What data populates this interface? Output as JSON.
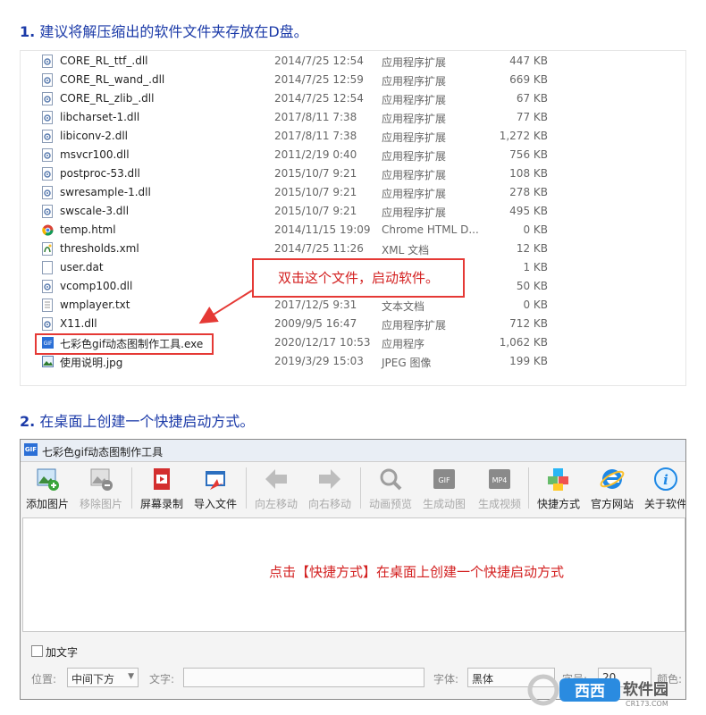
{
  "step1": {
    "num": "1.",
    "text": "建议将解压缩出的软件文件夹存放在D盘。"
  },
  "files": [
    {
      "name": "CORE_RL_ttf_.dll",
      "date": "2014/7/25 12:54",
      "type": "应用程序扩展",
      "size": "447 KB",
      "icon": "dll-icon"
    },
    {
      "name": "CORE_RL_wand_.dll",
      "date": "2014/7/25 12:59",
      "type": "应用程序扩展",
      "size": "669 KB",
      "icon": "dll-icon"
    },
    {
      "name": "CORE_RL_zlib_.dll",
      "date": "2014/7/25 12:54",
      "type": "应用程序扩展",
      "size": "67 KB",
      "icon": "dll-icon"
    },
    {
      "name": "libcharset-1.dll",
      "date": "2017/8/11 7:38",
      "type": "应用程序扩展",
      "size": "77 KB",
      "icon": "dll-icon"
    },
    {
      "name": "libiconv-2.dll",
      "date": "2017/8/11 7:38",
      "type": "应用程序扩展",
      "size": "1,272 KB",
      "icon": "dll-icon"
    },
    {
      "name": "msvcr100.dll",
      "date": "2011/2/19 0:40",
      "type": "应用程序扩展",
      "size": "756 KB",
      "icon": "dll-icon"
    },
    {
      "name": "postproc-53.dll",
      "date": "2015/10/7 9:21",
      "type": "应用程序扩展",
      "size": "108 KB",
      "icon": "dll-icon"
    },
    {
      "name": "swresample-1.dll",
      "date": "2015/10/7 9:21",
      "type": "应用程序扩展",
      "size": "278 KB",
      "icon": "dll-icon"
    },
    {
      "name": "swscale-3.dll",
      "date": "2015/10/7 9:21",
      "type": "应用程序扩展",
      "size": "495 KB",
      "icon": "dll-icon"
    },
    {
      "name": "temp.html",
      "date": "2014/11/15 19:09",
      "type": "Chrome HTML D...",
      "size": "0 KB",
      "icon": "chrome-icon"
    },
    {
      "name": "thresholds.xml",
      "date": "2014/7/25 11:26",
      "type": "XML 文档",
      "size": "12 KB",
      "icon": "xml-icon"
    },
    {
      "name": "user.dat",
      "date": "",
      "type": "",
      "size": "1 KB",
      "icon": "blank-file-icon"
    },
    {
      "name": "vcomp100.dll",
      "date": "",
      "type": "",
      "size": "50 KB",
      "icon": "dll-icon"
    },
    {
      "name": "wmplayer.txt",
      "date": "2017/12/5 9:31",
      "type": "文本文档",
      "size": "0 KB",
      "icon": "text-file-icon"
    },
    {
      "name": "X11.dll",
      "date": "2009/9/5 16:47",
      "type": "应用程序扩展",
      "size": "712 KB",
      "icon": "dll-icon"
    },
    {
      "name": "七彩色gif动态图制作工具.exe",
      "date": "2020/12/17 10:53",
      "type": "应用程序",
      "size": "1,062 KB",
      "icon": "gif-exe-icon"
    },
    {
      "name": "使用说明.jpg",
      "date": "2019/3/29 15:03",
      "type": "JPEG 图像",
      "size": "199 KB",
      "icon": "image-file-icon"
    }
  ],
  "callout1": "双击这个文件，启动软件。",
  "step2": {
    "num": "2.",
    "text": "在桌面上创建一个快捷启动方式。"
  },
  "app": {
    "icon_text": "GIF",
    "title": "七彩色gif动态图制作工具",
    "toolbar": [
      {
        "label": "添加图片",
        "icon": "add-image-icon"
      },
      {
        "label": "移除图片",
        "icon": "remove-image-icon"
      },
      {
        "label": "屏幕录制",
        "icon": "screen-record-icon"
      },
      {
        "label": "导入文件",
        "icon": "import-file-icon"
      },
      {
        "label": "向左移动",
        "icon": "arrow-left-icon"
      },
      {
        "label": "向右移动",
        "icon": "arrow-right-icon"
      },
      {
        "label": "动画预览",
        "icon": "magnifier-icon"
      },
      {
        "label": "生成动图",
        "icon": "gif-badge-icon",
        "badge": "GIF"
      },
      {
        "label": "生成视频",
        "icon": "mp4-badge-icon",
        "badge": "MP4"
      },
      {
        "label": "快捷方式",
        "icon": "cubes-icon"
      },
      {
        "label": "官方网站",
        "icon": "ie-icon"
      },
      {
        "label": "关于软件",
        "icon": "info-icon",
        "glyph": "i"
      }
    ],
    "hint": "点击【快捷方式】在桌面上创建一个快捷启动方式",
    "add_text_label": "加文字",
    "position_label": "位置:",
    "position_value": "中间下方",
    "text_label": "文字:",
    "font_label": "字体:",
    "font_value": "黑体",
    "size_label": "字号:",
    "size_value": "20",
    "color_label": "颜色:"
  },
  "watermark": {
    "brand": "西西软件园",
    "domain": "CR173.COM"
  },
  "colors": {
    "accent_blue": "#1b3aa8",
    "annotation_red": "#e53935"
  }
}
